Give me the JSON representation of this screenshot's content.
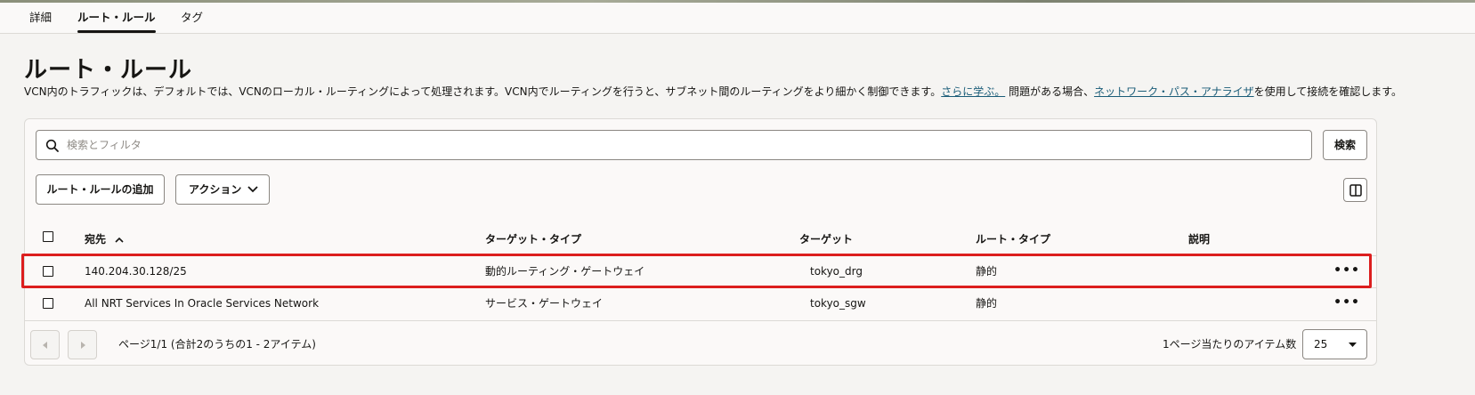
{
  "tabs": [
    {
      "label": "詳細"
    },
    {
      "label": "ルート・ルール",
      "active": true
    },
    {
      "label": "タグ"
    }
  ],
  "page": {
    "title": "ルート・ルール",
    "desc_part1": "VCN内のトラフィックは、デフォルトでは、VCNのローカル・ルーティングによって処理されます。VCN内でルーティングを行うと、サブネット間のルーティングをより細かく制御できます。",
    "learn_more": "さらに学ぶ。",
    "desc_part2": " 問題がある場合、",
    "analyzer_link": "ネットワーク・パス・アナライザ",
    "desc_part3": "を使用して接続を確認します。"
  },
  "search": {
    "placeholder": "検索とフィルタ",
    "button": "検索"
  },
  "toolbar": {
    "add_rule": "ルート・ルールの追加",
    "actions": "アクション"
  },
  "table": {
    "headers": {
      "destination": "宛先",
      "target_type": "ターゲット・タイプ",
      "target": "ターゲット",
      "route_type": "ルート・タイプ",
      "description": "説明"
    },
    "rows": [
      {
        "destination": "140.204.30.128/25",
        "target_type": "動的ルーティング・ゲートウェイ",
        "target": "tokyo_drg",
        "route_type": "静的",
        "description": "",
        "highlighted": true
      },
      {
        "destination": "All NRT Services In Oracle Services Network",
        "target_type": "サービス・ゲートウェイ",
        "target": "tokyo_sgw",
        "route_type": "静的",
        "description": ""
      }
    ],
    "more_label": "•••"
  },
  "pagination": {
    "info": "ページ1/1 (合計2のうちの1 - 2アイテム)",
    "per_page_label": "1ページ当たりのアイテム数",
    "per_page_value": "25"
  },
  "colors": {
    "highlight": "#dc1e1e",
    "link": "#1a5c78"
  }
}
